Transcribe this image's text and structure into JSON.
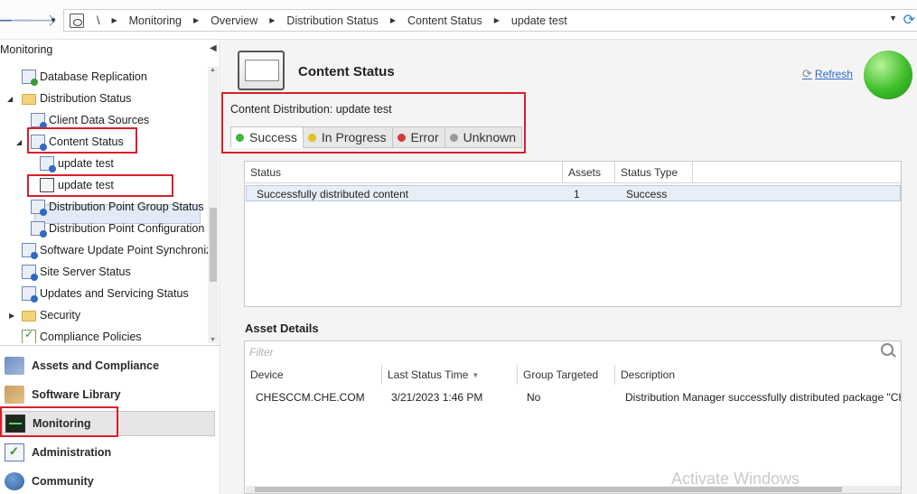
{
  "address_bar": {
    "root_crumb": "\\",
    "crumbs": [
      "Monitoring",
      "Overview",
      "Distribution Status",
      "Content Status",
      "update test"
    ]
  },
  "left_pane": {
    "title": "Monitoring",
    "tree": [
      {
        "label": "Database Replication"
      },
      {
        "label": "Distribution Status"
      },
      {
        "label": "Client Data Sources"
      },
      {
        "label": "Content Status"
      },
      {
        "label": "update test"
      },
      {
        "label": "update test"
      },
      {
        "label": "Distribution Point Group Status"
      },
      {
        "label": "Distribution Point Configuration"
      },
      {
        "label": "Software Update Point Synchroniz"
      },
      {
        "label": "Site Server Status"
      },
      {
        "label": "Updates and Servicing Status"
      },
      {
        "label": "Security"
      },
      {
        "label": "Compliance Policies"
      }
    ],
    "workspaces": [
      {
        "label": "Assets and Compliance"
      },
      {
        "label": "Software Library"
      },
      {
        "label": "Monitoring"
      },
      {
        "label": "Administration"
      },
      {
        "label": "Community"
      }
    ]
  },
  "header": {
    "title": "Content Status",
    "refresh_label": "Refresh"
  },
  "content_distribution": {
    "label": "Content Distribution: update test",
    "tabs": [
      {
        "label": "Success",
        "color": "#3cb63c"
      },
      {
        "label": "In Progress",
        "color": "#e1c21e"
      },
      {
        "label": "Error",
        "color": "#d43a3a"
      },
      {
        "label": "Unknown",
        "color": "#9a9a9a"
      }
    ]
  },
  "status_grid": {
    "headers": [
      "Status",
      "Assets",
      "Status Type"
    ],
    "rows": [
      {
        "status": "Successfully distributed content",
        "assets": "1",
        "status_type": "Success"
      }
    ]
  },
  "asset_details": {
    "title": "Asset Details",
    "filter_placeholder": "Filter",
    "headers": [
      "Device",
      "Last Status Time",
      "Group Targeted",
      "Description"
    ],
    "rows": [
      {
        "device": "CHESCCM.CHE.COM",
        "last_status_time": "3/21/2023 1:46 PM",
        "group_targeted": "No",
        "description": "Distribution Manager successfully distributed package \"CH"
      }
    ]
  },
  "watermark": "Activate Windows"
}
